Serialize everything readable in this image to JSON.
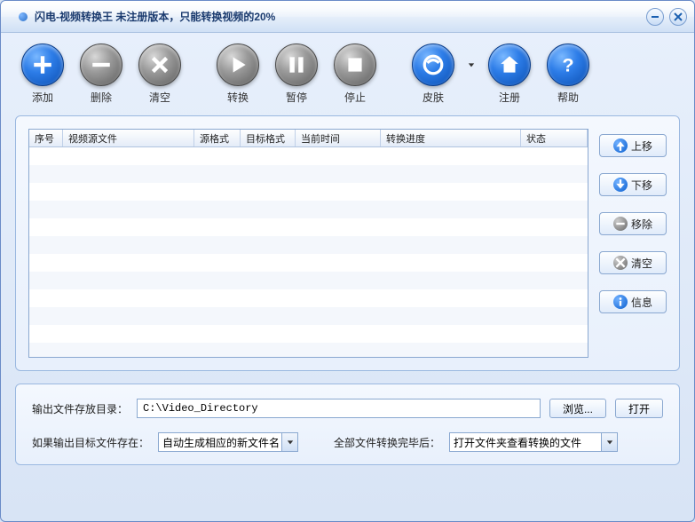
{
  "title": "闪电-视频转换王  未注册版本，只能转换视频的20%",
  "toolbar": {
    "add": "添加",
    "remove": "删除",
    "clear": "清空",
    "convert": "转换",
    "pause": "暂停",
    "stop": "停止",
    "skin": "皮肤",
    "register": "注册",
    "help": "帮助"
  },
  "table": {
    "columns": [
      "序号",
      "视频源文件",
      "源格式",
      "目标格式",
      "当前时间",
      "转换进度",
      "状态"
    ],
    "rows": []
  },
  "side": {
    "up": "上移",
    "down": "下移",
    "remove": "移除",
    "clear": "清空",
    "info": "信息"
  },
  "footer": {
    "output_label": "输出文件存放目录：",
    "output_value": "C:\\Video_Directory",
    "browse": "浏览...",
    "open": "打开",
    "exists_label": "如果输出目标文件存在：",
    "exists_value": "自动生成相应的新文件名",
    "after_label": "全部文件转换完毕后：",
    "after_value": "打开文件夹查看转换的文件"
  }
}
